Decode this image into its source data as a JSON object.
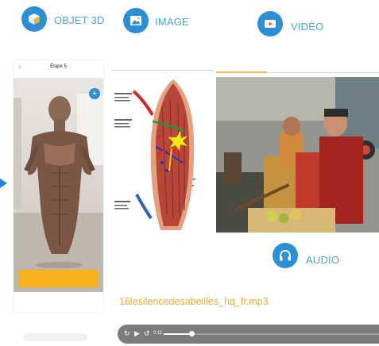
{
  "header": {
    "objet3d_label": "OBJET 3D",
    "image_label": "IMAGE",
    "video_label": "VIDÉO",
    "audio_label": "AUDIO"
  },
  "phone": {
    "title": "Étape 5",
    "back_icon": "chevron-left-icon",
    "ar_link_text": "",
    "plus_label": "+",
    "action_button_label": ""
  },
  "audio": {
    "filename": "16lesilencedesabeilles_hq_fr.mp3",
    "time": "0:11",
    "progress": 0.13
  },
  "colors": {
    "accent_blue": "#2a8fd4",
    "label_blue": "#4aa3df",
    "orange": "#f2a93b",
    "button_yellow": "#f6b21b",
    "player_gray": "#7b7b7b"
  }
}
